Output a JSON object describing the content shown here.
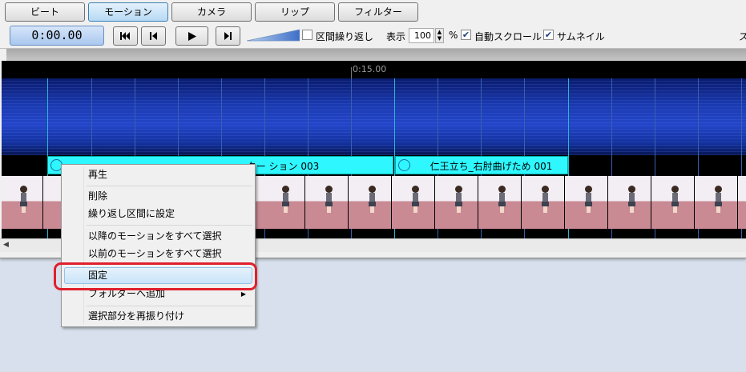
{
  "tabs": [
    "ビート",
    "モーション",
    "カメラ",
    "リップ",
    "フィルター"
  ],
  "active_tab": "モーション",
  "toolbar": {
    "time": "0:00.00",
    "loop_label": "区間繰り返し",
    "loop_checked": false,
    "display_label": "表示",
    "zoom_value": "100",
    "percent": "%",
    "autoscroll_label": "自動スクロール",
    "autoscroll_checked": true,
    "thumbnail_label": "サムネイル",
    "thumbnail_checked": true,
    "cut_text": "ス"
  },
  "timeline": {
    "tick_label": "0:15.00",
    "clips": [
      {
        "label": "…ター ション 003"
      },
      {
        "label": "仁王立ち_右肘曲げため 001"
      }
    ]
  },
  "context_menu": {
    "items": [
      "再生",
      "削除",
      "繰り返し区間に設定",
      "以降のモーションをすべて選択",
      "以前のモーションをすべて選択",
      "固定",
      "フォルダーへ追加",
      "選択部分を再振り付け"
    ],
    "highlighted": "固定"
  },
  "colors": {
    "clip": "#2ff7ff",
    "annotation_ring": "#e0202c",
    "highlight": "#c9e3f8"
  }
}
